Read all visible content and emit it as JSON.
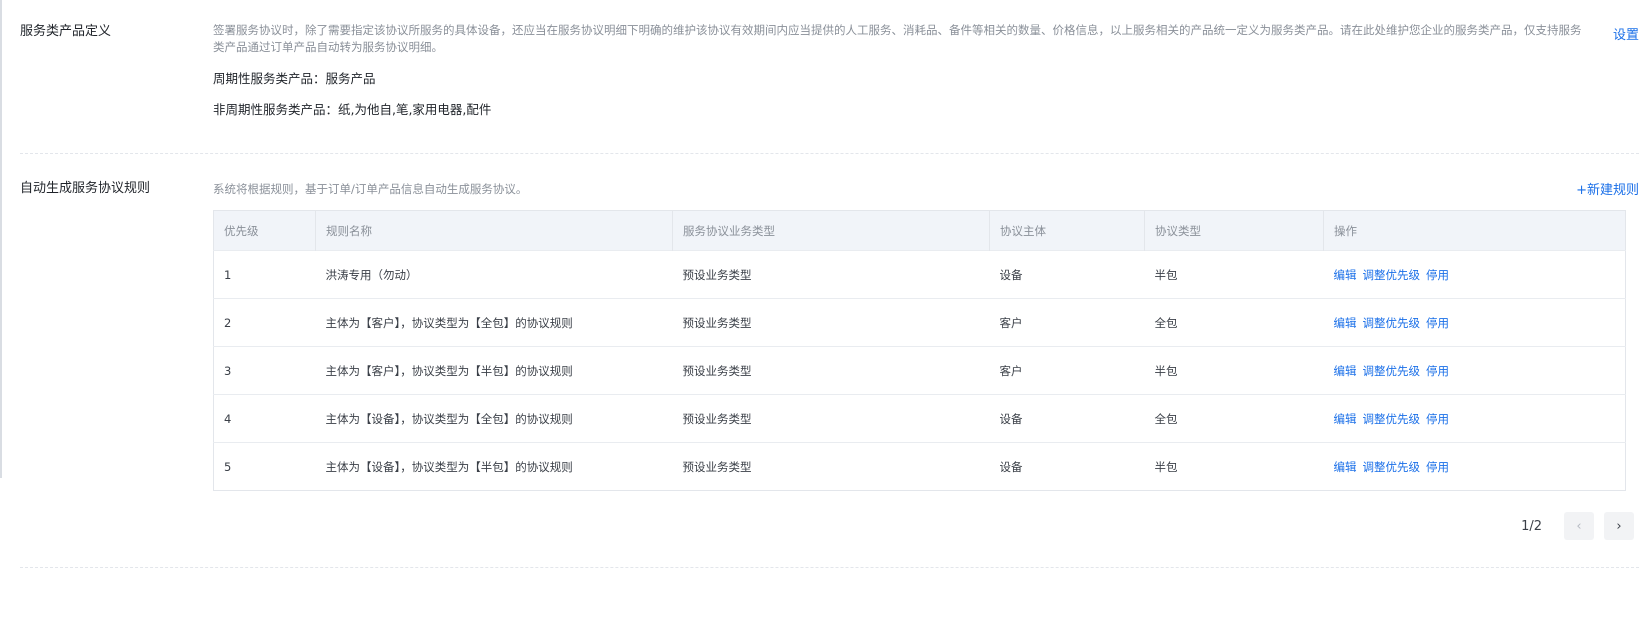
{
  "service_product": {
    "title": "服务类产品定义",
    "description": "签署服务协议时，除了需要指定该协议所服务的具体设备，还应当在服务协议明细下明确的维护该协议有效期间内应当提供的人工服务、消耗品、备件等相关的数量、价格信息，以上服务相关的产品统一定义为服务类产品。请在此处维护您企业的服务类产品，仅支持服务类产品通过订单产品自动转为服务协议明细。",
    "periodic": "周期性服务类产品：服务产品",
    "non_periodic": "非周期性服务类产品：纸,为他自,笔,家用电器,配件",
    "setting_label": "设置"
  },
  "auto_rules": {
    "title": "自动生成服务协议规则",
    "description": "系统将根据规则，基于订单/订单产品信息自动生成服务协议。",
    "new_rule_label": "+新建规则",
    "columns": [
      "优先级",
      "规则名称",
      "服务协议业务类型",
      "协议主体",
      "协议类型",
      "操作"
    ],
    "rows": [
      {
        "priority": "1",
        "name": "洪涛专用（勿动）",
        "biz_type": "预设业务类型",
        "subject": "设备",
        "type": "半包"
      },
      {
        "priority": "2",
        "name": "主体为【客户】，协议类型为【全包】的协议规则",
        "biz_type": "预设业务类型",
        "subject": "客户",
        "type": "全包"
      },
      {
        "priority": "3",
        "name": "主体为【客户】，协议类型为【半包】的协议规则",
        "biz_type": "预设业务类型",
        "subject": "客户",
        "type": "半包"
      },
      {
        "priority": "4",
        "name": "主体为【设备】，协议类型为【全包】的协议规则",
        "biz_type": "预设业务类型",
        "subject": "设备",
        "type": "全包"
      },
      {
        "priority": "5",
        "name": "主体为【设备】，协议类型为【半包】的协议规则",
        "biz_type": "预设业务类型",
        "subject": "设备",
        "type": "半包"
      }
    ],
    "actions": {
      "edit": "编辑",
      "priority": "调整优先级",
      "disable": "停用"
    },
    "pagination": {
      "text": "1/2",
      "prev_icon": "‹",
      "next_icon": "›"
    }
  }
}
